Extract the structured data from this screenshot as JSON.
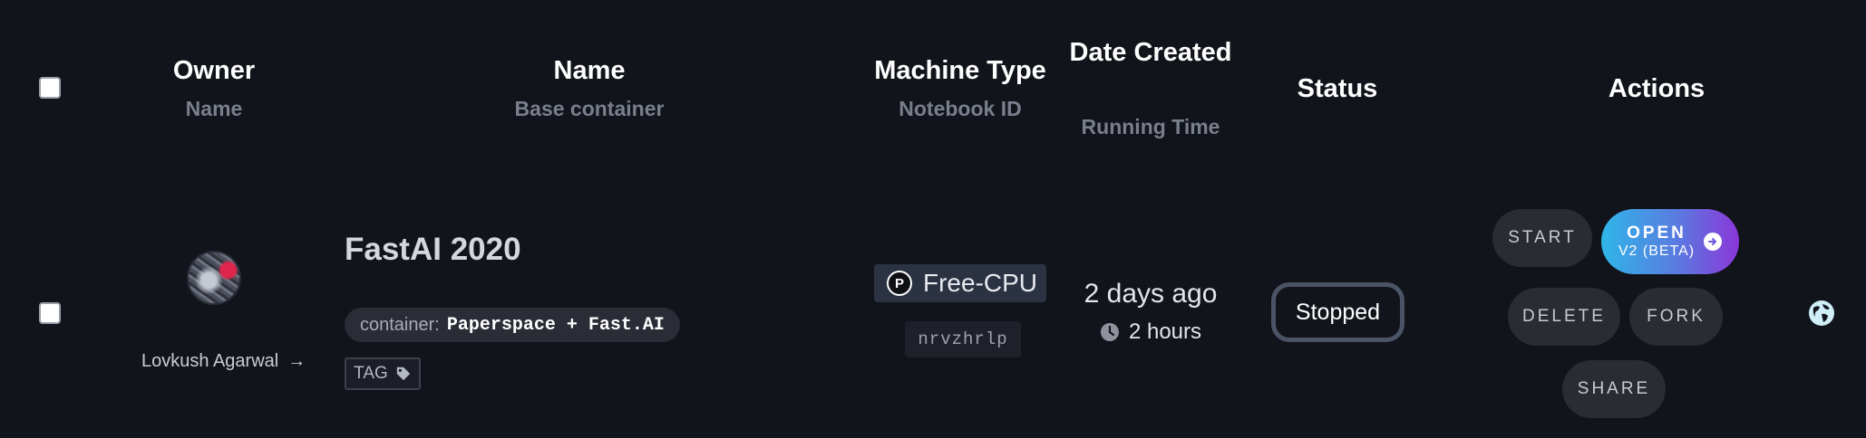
{
  "header": {
    "owner": "Owner",
    "owner_sub": "Name",
    "name": "Name",
    "name_sub": "Base container",
    "machine_type": "Machine Type",
    "machine_type_sub": "Notebook ID",
    "date_created": "Date Created",
    "date_created_sub": "Running Time",
    "status": "Status",
    "actions": "Actions"
  },
  "row": {
    "owner_name": "Lovkush Agarwal",
    "notebook_name": "FastAI 2020",
    "container_label": "container:",
    "container_value": "Paperspace + Fast.AI",
    "tag_label": "TAG",
    "machine_icon_letter": "P",
    "machine_type": "Free-CPU",
    "notebook_id": "nrvzhrlp",
    "date_created": "2 days ago",
    "running_time": "2 hours",
    "status": "Stopped",
    "actions": {
      "start": "START",
      "open": "OPEN",
      "open_sub": "V2 (BETA)",
      "delete": "DELETE",
      "fork": "FORK",
      "share": "SHARE"
    }
  },
  "colors": {
    "background": "#11141b",
    "open_gradient_start": "#2fb6e8",
    "open_gradient_end": "#8b36d9",
    "status_border": "#4a5466",
    "globe": "#cfeef8"
  },
  "icons": [
    "arrow-right-icon",
    "tag-icon",
    "paperspace-p-icon",
    "clock-icon",
    "arrow-circle-right-icon",
    "globe-icon"
  ]
}
